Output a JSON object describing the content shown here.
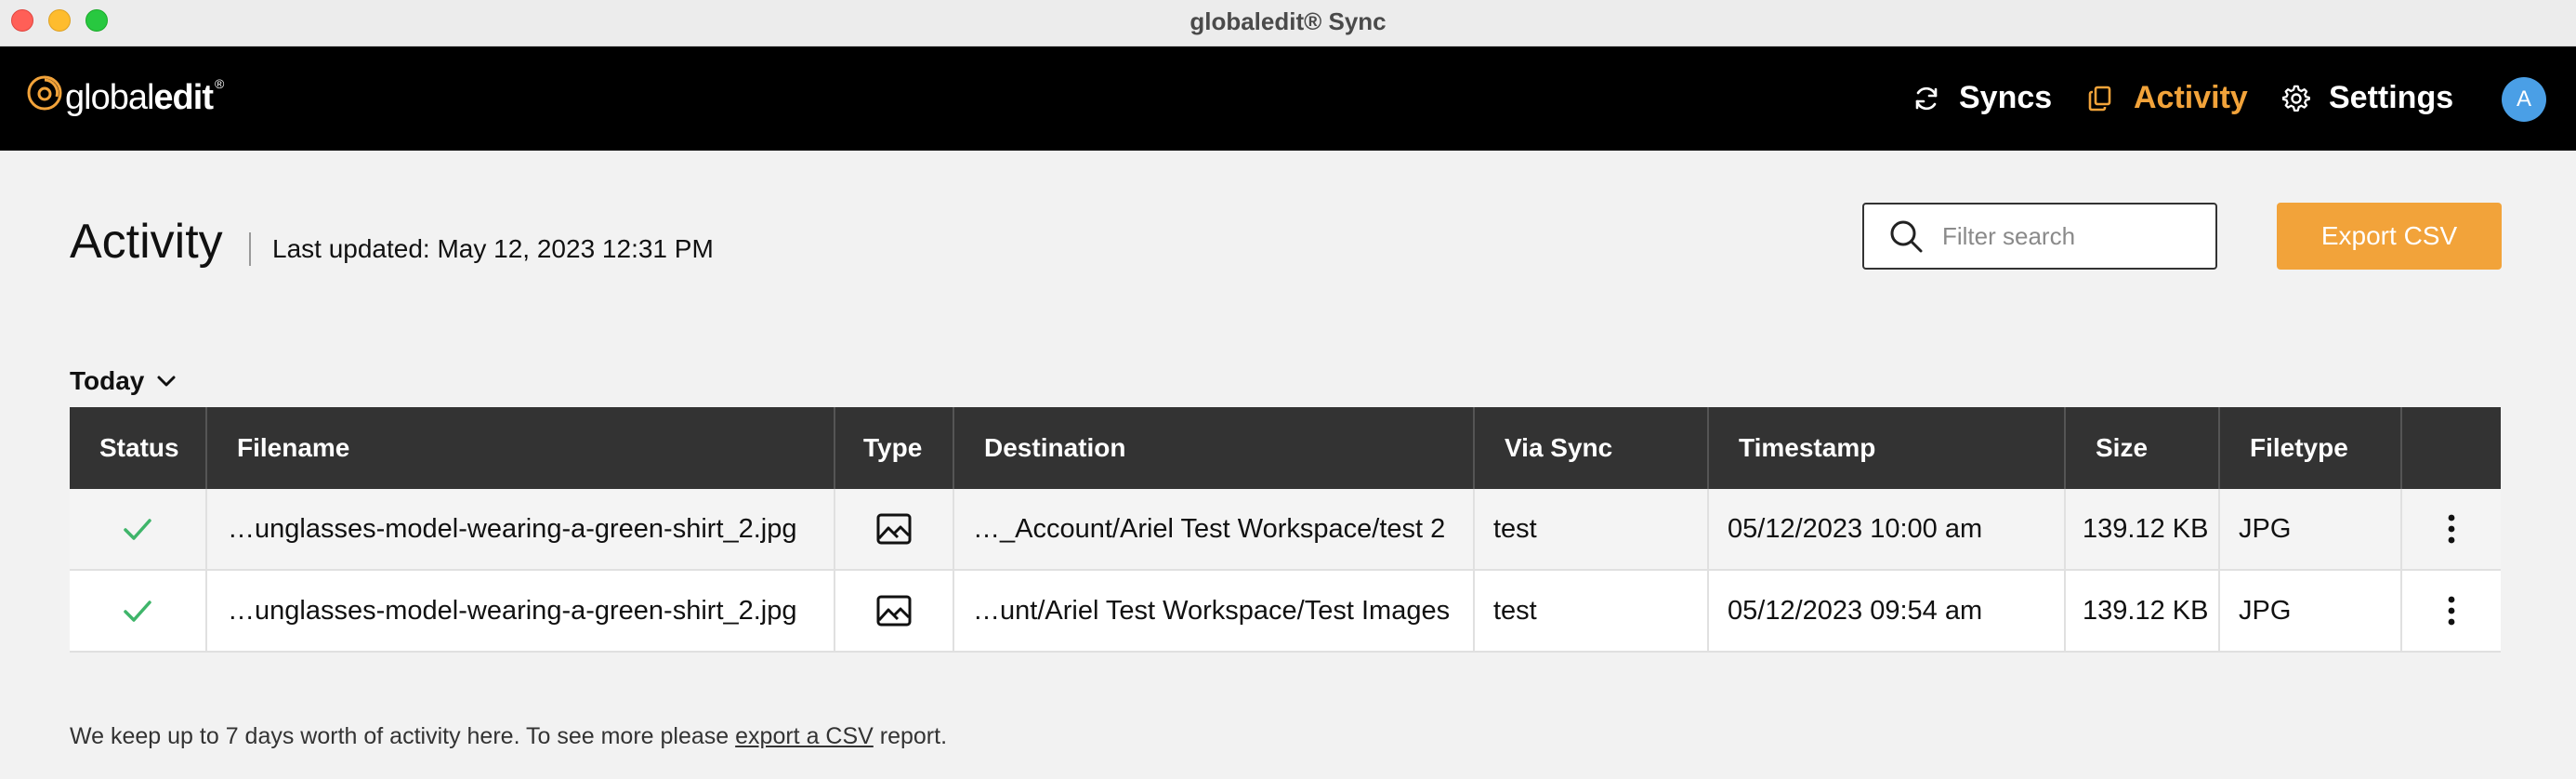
{
  "window": {
    "title": "globaledit® Sync"
  },
  "brand": {
    "name_light": "global",
    "name_bold": "edit",
    "reg": "®",
    "accent": "#f2a33a"
  },
  "nav": {
    "syncs": "Syncs",
    "activity": "Activity",
    "settings": "Settings",
    "avatar_initial": "A"
  },
  "page": {
    "title": "Activity",
    "last_updated": "Last updated: May 12, 2023 12:31 PM"
  },
  "search": {
    "placeholder": "Filter search",
    "value": ""
  },
  "export_button": "Export CSV",
  "range": {
    "selected": "Today"
  },
  "table": {
    "headers": [
      "Status",
      "Filename",
      "Type",
      "Destination",
      "Via Sync",
      "Timestamp",
      "Size",
      "Filetype"
    ],
    "rows": [
      {
        "status": "success",
        "filename": "…unglasses-model-wearing-a-green-shirt_2.jpg",
        "type_icon": "image-icon",
        "destination": "…_Account/Ariel Test Workspace/test 2",
        "via_sync": "test",
        "timestamp": "05/12/2023 10:00 am",
        "size": "139.12 KB",
        "filetype": "JPG"
      },
      {
        "status": "success",
        "filename": "…unglasses-model-wearing-a-green-shirt_2.jpg",
        "type_icon": "image-icon",
        "destination": "…unt/Ariel Test Workspace/Test Images",
        "via_sync": "test",
        "timestamp": "05/12/2023 09:54 am",
        "size": "139.12 KB",
        "filetype": "JPG"
      }
    ]
  },
  "footer": {
    "before": "We keep up to 7 days worth of activity here. To see more please ",
    "link": "export a CSV",
    "after": " report."
  }
}
